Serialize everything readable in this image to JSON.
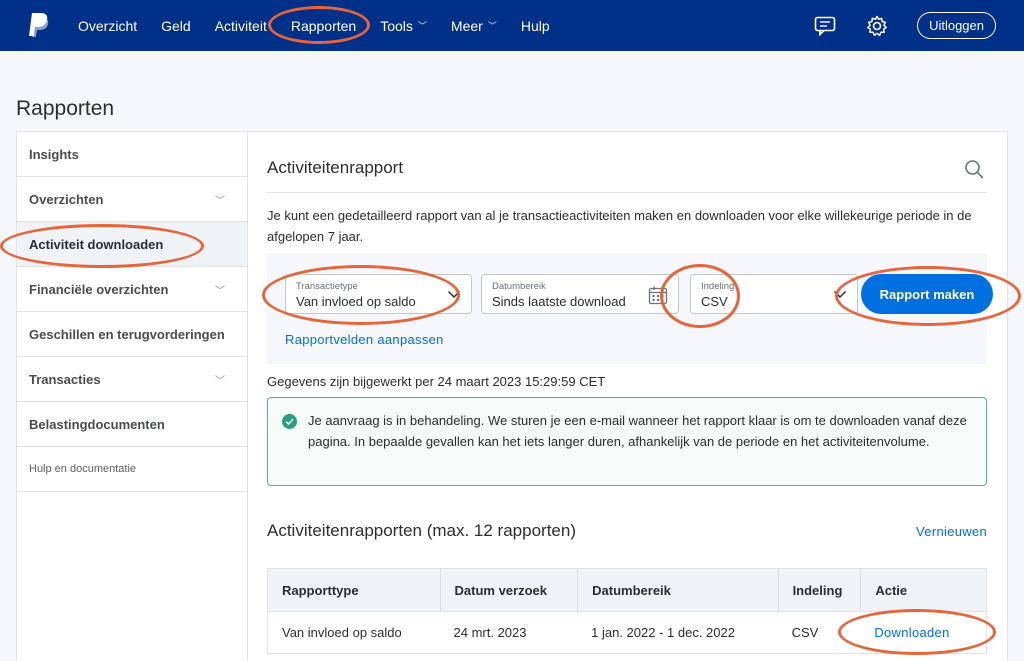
{
  "nav": {
    "items": [
      {
        "label": "Overzicht",
        "dropdown": false
      },
      {
        "label": "Geld",
        "dropdown": false
      },
      {
        "label": "Activiteit",
        "dropdown": false
      },
      {
        "label": "Rapporten",
        "dropdown": false
      },
      {
        "label": "Tools",
        "dropdown": true
      },
      {
        "label": "Meer",
        "dropdown": true
      },
      {
        "label": "Hulp",
        "dropdown": false
      }
    ],
    "logout_label": "Uitloggen",
    "icons": [
      "paypal-logo",
      "messages-icon",
      "gear-icon"
    ]
  },
  "page_title": "Rapporten",
  "sidebar": {
    "items": [
      {
        "label": "Insights",
        "expandable": false
      },
      {
        "label": "Overzichten",
        "expandable": true
      },
      {
        "label": "Activiteit downloaden",
        "expandable": false,
        "active": true
      },
      {
        "label": "Financiële overzichten",
        "expandable": true
      },
      {
        "label": "Geschillen en terugvorderingen",
        "expandable": false
      },
      {
        "label": "Transacties",
        "expandable": true
      },
      {
        "label": "Belastingdocumenten",
        "expandable": false
      },
      {
        "label": "Hulp en documentatie",
        "expandable": false
      }
    ]
  },
  "main": {
    "title": "Activiteitenrapport",
    "description": "Je kunt een gedetailleerd rapport van al je transactieactiviteiten maken en downloaden voor elke willekeurige periode in de afgelopen 7 jaar.",
    "filters": {
      "transaction_type": {
        "label": "Transactietype",
        "value": "Van invloed op saldo"
      },
      "date_range": {
        "label": "Datumbereik",
        "value": "Sinds laatste download"
      },
      "format": {
        "label": "Indeling",
        "value": "CSV"
      },
      "submit_label": "Rapport maken",
      "customize_label": "Rapportvelden aanpassen"
    },
    "updated_text": "Gegevens zijn bijgewerkt per 24 maart 2023 15:29:59 CET",
    "notice_text": "Je aanvraag is in behandeling. We sturen je een e-mail wanneer het rapport klaar is om te downloaden vanaf deze pagina. In bepaalde gevallen kan het iets langer duren, afhankelijk van de periode en het activiteitenvolume.",
    "reports_title": "Activiteitenrapporten (max. 12 rapporten)",
    "refresh_label": "Vernieuwen",
    "table": {
      "headers": [
        "Rapporttype",
        "Datum verzoek",
        "Datumbereik",
        "Indeling",
        "Actie"
      ],
      "rows": [
        [
          "Van invloed op saldo",
          "24 mrt. 2023",
          "1 jan. 2022 - 1 dec. 2022",
          "CSV",
          "Downloaden"
        ]
      ]
    }
  },
  "colors": {
    "nav_bg": "#003087",
    "accent": "#0070e0",
    "highlight": "#e8643a",
    "notice_border": "#61a89a"
  }
}
